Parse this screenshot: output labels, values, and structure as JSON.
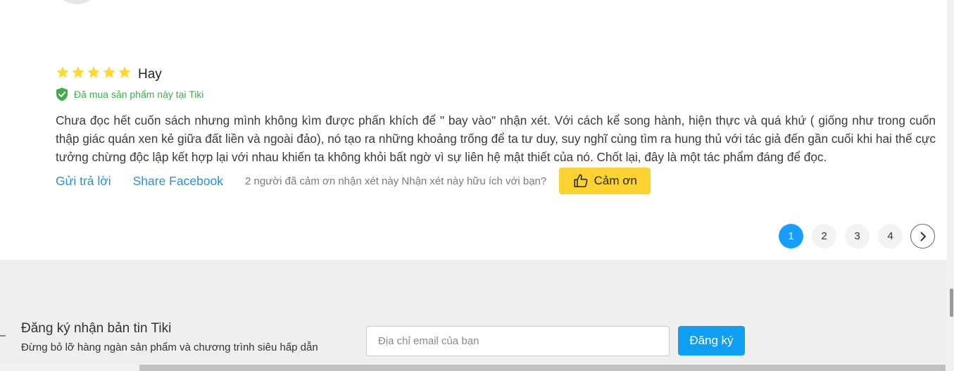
{
  "review": {
    "rating": 5,
    "title": "Hay",
    "verified_text": "Đã mua sản phẩm này tại Tiki",
    "body": "Chưa đọc hết cuốn sách nhưng mình không kìm được phấn khích để \" bay vào\" nhận xét. Với cách kể song hành, hiện thực và quá khứ ( giống như trong cuốn thập giác quán xen kẻ giữa đất liền và ngoài đảo), nó tạo ra những khoảng trống để ta tư duy, suy nghĩ cùng tìm ra hung thủ với tác giả đến gần cuối khi hai thế cực tưởng chừng độc lập kết hợp lại với nhau khiến ta không khỏi bất ngờ vì sự liên hệ mật thiết của nó. Chốt lại, đây là một tác phẩm đáng để đọc.",
    "reply_label": "Gửi trả lời",
    "share_label": "Share Facebook",
    "thanks_info": "2 người đã cảm ơn nhận xét này Nhận xét này hữu ích với bạn?",
    "thanks_button": "Cảm ơn"
  },
  "pagination": {
    "pages": [
      "1",
      "2",
      "3",
      "4"
    ],
    "active": "1"
  },
  "newsletter": {
    "title": "Đăng ký nhận bản tin Tiki",
    "subtitle": "Đừng bỏ lỡ hàng ngàn sản phẩm và chương trình siêu hấp dẫn",
    "email_placeholder": "Địa chỉ email của bạn",
    "subscribe_label": "Đăng ký"
  },
  "colors": {
    "star": "#fdd836",
    "verified": "#3fae4a",
    "link": "#2c8fd6",
    "thanks_button": "#fdd333",
    "active_page": "#189eff",
    "subscribe_button": "#0e9ff2"
  },
  "icons": [
    "star-icon",
    "verified-shield-icon",
    "thumbs-up-icon",
    "chevron-right-icon"
  ]
}
